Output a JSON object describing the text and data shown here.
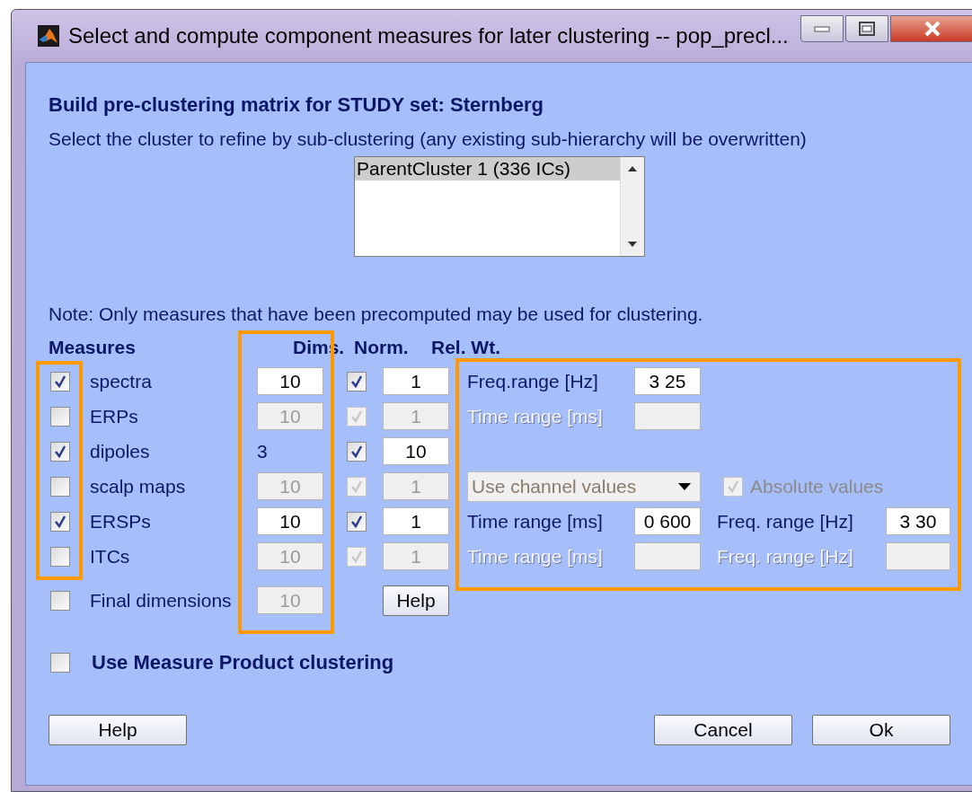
{
  "window": {
    "title": "Select and compute component measures for later clustering -- pop_precl..."
  },
  "heading": "Build pre-clustering matrix for STUDY set:  Sternberg",
  "instruction": "Select the cluster to refine by sub-clustering (any existing sub-hierarchy will be overwritten)",
  "cluster_list": {
    "items": [
      {
        "label": "ParentCluster 1 (336 ICs)",
        "selected": true
      }
    ]
  },
  "note": "Note: Only measures that have been precomputed may be used for clustering.",
  "columns": [
    "Measures",
    "Dims.",
    "Norm.",
    "Rel. Wt."
  ],
  "measures": [
    {
      "label": "spectra",
      "checked": true,
      "disabled": false,
      "dims": {
        "kind": "field",
        "value": "10"
      },
      "norm": true,
      "weight": "1",
      "options": [
        {
          "kind": "range",
          "label": "Freq.range [Hz]",
          "value": "3  25",
          "disabled": false
        }
      ]
    },
    {
      "label": "ERPs",
      "checked": false,
      "disabled": true,
      "dims": {
        "kind": "field",
        "value": "10"
      },
      "norm": true,
      "weight": "1",
      "options": [
        {
          "kind": "range",
          "label": "Time range [ms]",
          "disabled": true
        }
      ]
    },
    {
      "label": "dipoles",
      "checked": true,
      "disabled": false,
      "dims": {
        "kind": "text",
        "value": "3"
      },
      "norm": true,
      "weight": "10"
    },
    {
      "label": "scalp maps",
      "checked": false,
      "disabled": true,
      "dims": {
        "kind": "field",
        "value": "10"
      },
      "norm": true,
      "weight": "1",
      "options": [
        {
          "kind": "dropdown",
          "value": "Use channel values",
          "disabled": true
        },
        {
          "kind": "checkbox",
          "label": "Absolute values",
          "checked": true,
          "disabled": true
        }
      ]
    },
    {
      "label": "ERSPs",
      "checked": true,
      "disabled": false,
      "dims": {
        "kind": "field",
        "value": "10"
      },
      "norm": true,
      "weight": "1",
      "options": [
        {
          "kind": "range",
          "label": "Time range [ms]",
          "value": "0 600",
          "disabled": false
        },
        {
          "kind": "range",
          "label": "Freq. range [Hz]",
          "value": "3 30",
          "disabled": false
        }
      ]
    },
    {
      "label": "ITCs",
      "checked": false,
      "disabled": true,
      "dims": {
        "kind": "field",
        "value": "10"
      },
      "norm": true,
      "weight": "1",
      "options": [
        {
          "kind": "range",
          "label": "Time range [ms]",
          "disabled": true
        },
        {
          "kind": "range",
          "label": "Freq. range [Hz]",
          "disabled": true
        }
      ]
    }
  ],
  "final_dimensions": {
    "label": "Final dimensions",
    "checked": false,
    "value": "10",
    "disabled": true
  },
  "help_inline": "Help",
  "product_clustering": {
    "label": "Use Measure Product clustering",
    "checked": false
  },
  "buttons": [
    {
      "label": "Help",
      "kind": "left"
    },
    {
      "label": "Cancel",
      "kind": "right"
    },
    {
      "label": "Ok",
      "kind": "right"
    }
  ]
}
